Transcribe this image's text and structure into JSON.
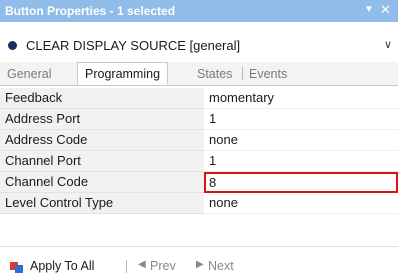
{
  "window": {
    "title": "Button Properties - 1 selected",
    "pin_icon": "pin-icon",
    "close_icon": "close-icon"
  },
  "selector": {
    "value": "CLEAR DISPLAY SOURCE  [general]",
    "dot_color": "#1e2b5e"
  },
  "tabs": [
    {
      "label": "General",
      "active": false
    },
    {
      "label": "Programming",
      "active": true
    },
    {
      "label": "States",
      "active": false
    },
    {
      "label": "Events",
      "active": false
    }
  ],
  "properties": [
    {
      "name": "Feedback",
      "value": "momentary"
    },
    {
      "name": "Address Port",
      "value": "1"
    },
    {
      "name": "Address Code",
      "value": "none"
    },
    {
      "name": "Channel Port",
      "value": "1"
    },
    {
      "name": "Channel Code",
      "value": "8"
    },
    {
      "name": "Level Control Type",
      "value": "none"
    }
  ],
  "footer": {
    "apply_label": "Apply To All",
    "prev_label": "Prev",
    "next_label": "Next"
  },
  "colors": {
    "titlebar": "#8fbce8",
    "highlight_border": "#d51515"
  }
}
